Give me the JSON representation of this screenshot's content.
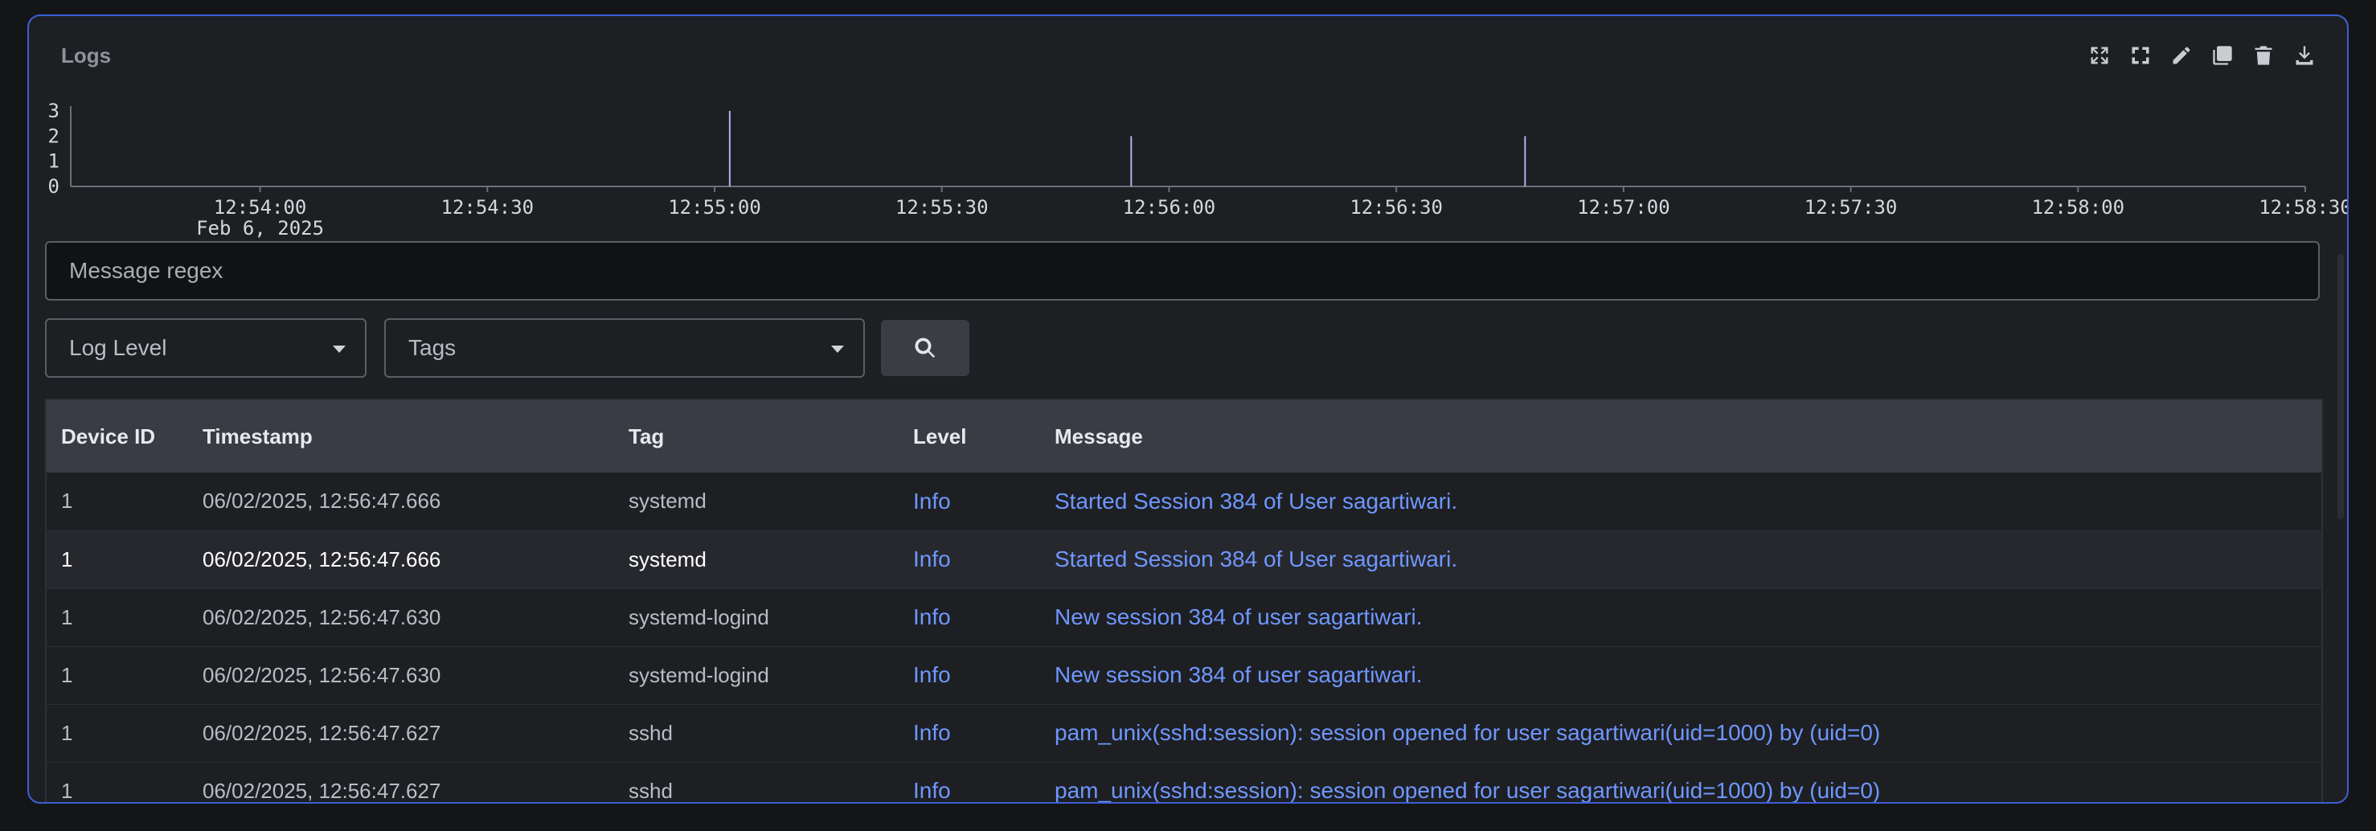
{
  "panel": {
    "title": "Logs",
    "toolbar": [
      {
        "name": "expand-icon"
      },
      {
        "name": "fullscreen-icon"
      },
      {
        "name": "edit-icon"
      },
      {
        "name": "duplicate-icon"
      },
      {
        "name": "delete-icon"
      },
      {
        "name": "download-icon"
      }
    ]
  },
  "chart_data": {
    "type": "bar",
    "y_ticks": [
      "3",
      "2",
      "1",
      "0"
    ],
    "ylim": [
      0,
      3
    ],
    "x_ticks": [
      "12:54:00",
      "12:54:30",
      "12:55:00",
      "12:55:30",
      "12:56:00",
      "12:56:30",
      "12:57:00",
      "12:57:30",
      "12:58:00",
      "12:58:30"
    ],
    "x_date_label": "Feb 6, 2025",
    "x_range": [
      "12:53:35",
      "12:58:30"
    ],
    "bars": [
      {
        "x": "12:55:02",
        "value": 3
      },
      {
        "x": "12:55:55",
        "value": 2
      },
      {
        "x": "12:56:47",
        "value": 2
      }
    ],
    "bar_color": "#a9b7e8"
  },
  "filters": {
    "regex_placeholder": "Message regex",
    "log_level_label": "Log Level",
    "tags_label": "Tags",
    "search_icon": "search-icon"
  },
  "table": {
    "headers": [
      "Device ID",
      "Timestamp",
      "Tag",
      "Level",
      "Message"
    ],
    "rows": [
      {
        "device": "1",
        "timestamp": "06/02/2025, 12:56:47.666",
        "tag": "systemd",
        "level": "Info",
        "message": "Started Session 384 of User sagartiwari."
      },
      {
        "device": "1",
        "timestamp": "06/02/2025, 12:56:47.666",
        "tag": "systemd",
        "level": "Info",
        "message": "Started Session 384 of User sagartiwari."
      },
      {
        "device": "1",
        "timestamp": "06/02/2025, 12:56:47.630",
        "tag": "systemd-logind",
        "level": "Info",
        "message": "New session 384 of user sagartiwari."
      },
      {
        "device": "1",
        "timestamp": "06/02/2025, 12:56:47.630",
        "tag": "systemd-logind",
        "level": "Info",
        "message": "New session 384 of user sagartiwari."
      },
      {
        "device": "1",
        "timestamp": "06/02/2025, 12:56:47.627",
        "tag": "sshd",
        "level": "Info",
        "message": "pam_unix(sshd:session): session opened for user sagartiwari(uid=1000) by (uid=0)"
      },
      {
        "device": "1",
        "timestamp": "06/02/2025, 12:56:47.627",
        "tag": "sshd",
        "level": "Info",
        "message": "pam_unix(sshd:session): session opened for user sagartiwari(uid=1000) by (uid=0)"
      }
    ]
  },
  "colors": {
    "accent": "#6f97ff",
    "panel_border": "#3c5fd6"
  }
}
